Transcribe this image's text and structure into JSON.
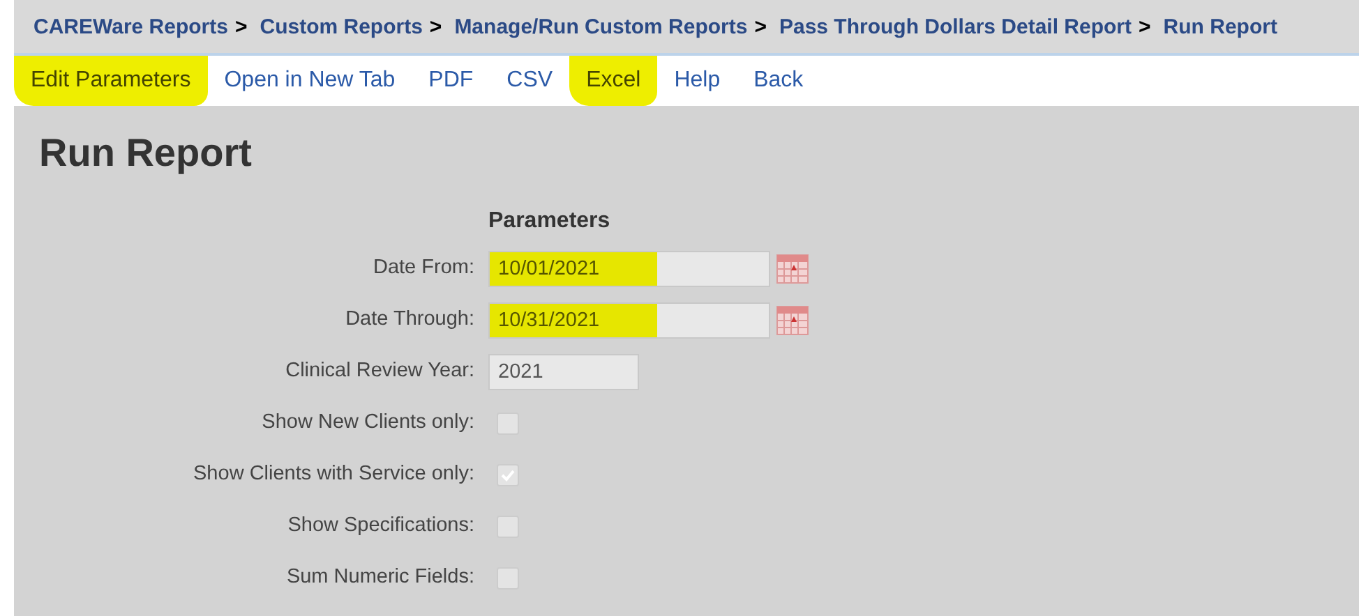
{
  "breadcrumbs": [
    {
      "label": "CAREWare Reports",
      "separator": ">"
    },
    {
      "label": "Custom Reports",
      "separator": ">"
    },
    {
      "label": "Manage/Run Custom Reports",
      "separator": ">"
    },
    {
      "label": "Pass Through Dollars Detail Report",
      "separator": ">"
    },
    {
      "label": "Run Report"
    }
  ],
  "toolbar": [
    {
      "label": "Edit Parameters",
      "highlighted": true
    },
    {
      "label": "Open in New Tab",
      "highlighted": false
    },
    {
      "label": "PDF",
      "highlighted": false
    },
    {
      "label": "CSV",
      "highlighted": false
    },
    {
      "label": "Excel",
      "highlighted": true
    },
    {
      "label": "Help",
      "highlighted": false
    },
    {
      "label": "Back",
      "highlighted": false
    }
  ],
  "page_title": "Run Report",
  "parameters": {
    "heading": "Parameters",
    "fields": [
      {
        "kind": "date",
        "label": "Date From:",
        "value": "10/01/2021",
        "highlighted": true
      },
      {
        "kind": "date",
        "label": "Date Through:",
        "value": "10/31/2021",
        "highlighted": true
      },
      {
        "kind": "text",
        "label": "Clinical Review Year:",
        "value": "2021"
      },
      {
        "kind": "checkbox",
        "label": "Show New Clients only:",
        "checked": false
      },
      {
        "kind": "checkbox",
        "label": "Show Clients with Service only:",
        "checked": true
      },
      {
        "kind": "checkbox",
        "label": "Show Specifications:",
        "checked": false
      },
      {
        "kind": "checkbox",
        "label": "Sum Numeric Fields:",
        "checked": false
      }
    ]
  }
}
